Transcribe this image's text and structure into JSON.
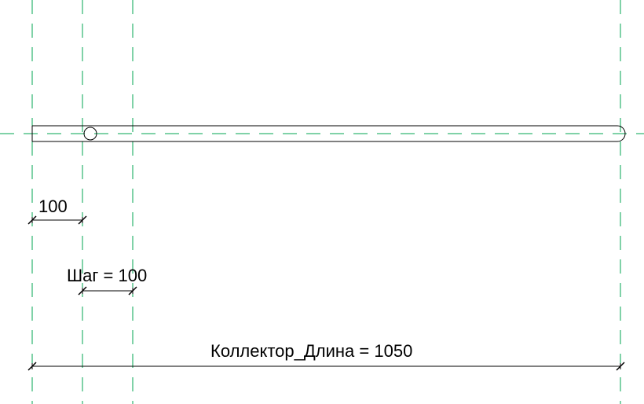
{
  "colors": {
    "reference_line": "#00a651",
    "geometry": "#000000",
    "background": "#ffffff"
  },
  "dimensions": {
    "offset": {
      "label": "100",
      "value": 100
    },
    "step": {
      "label": "Шаг = 100",
      "value": 100
    },
    "length": {
      "label": "Коллектор_Длина = 1050",
      "value": 1050
    }
  },
  "geometry": {
    "type": "collector-pipe",
    "hole_count_visible": 1
  }
}
